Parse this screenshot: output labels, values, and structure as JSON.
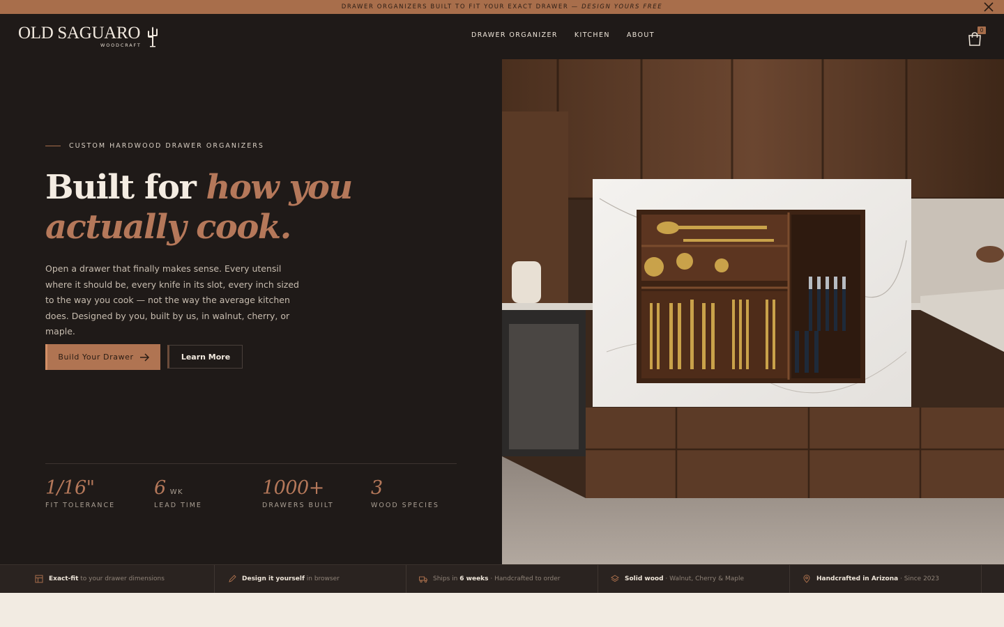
{
  "announcement": {
    "text": "DRAWER ORGANIZERS BUILT TO FIT YOUR EXACT DRAWER — ",
    "emphasis": "DESIGN YOURS FREE"
  },
  "header": {
    "logo_main": "OLD SAGUARO",
    "logo_sub": "WOODCRAFT",
    "nav": [
      "DRAWER ORGANIZER",
      "KITCHEN",
      "ABOUT"
    ],
    "cart_count": "0"
  },
  "hero": {
    "eyebrow": "CUSTOM HARDWOOD DRAWER ORGANIZERS",
    "headline_plain": "Built for ",
    "headline_accent": "how you actually cook.",
    "description": "Open a drawer that finally makes sense. Every utensil where it should be, every knife in its slot, every inch sized to the way you cook — not the way the average kitchen does. Designed by you, built by us, in walnut, cherry, or maple.",
    "primary_button": "Build Your Drawer",
    "secondary_button": "Learn More",
    "stats": [
      {
        "value": "1/16\"",
        "unit": "",
        "label": "FIT TOLERANCE"
      },
      {
        "value": "6",
        "unit": "WK",
        "label": "LEAD TIME"
      },
      {
        "value": "1000+",
        "unit": "",
        "label": "DRAWERS BUILT"
      },
      {
        "value": "3",
        "unit": "",
        "label": "WOOD SPECIES"
      }
    ]
  },
  "features": [
    {
      "icon": "ruler-icon",
      "bold": "Exact-fit",
      "rest": " to your drawer dimensions"
    },
    {
      "icon": "pencil-icon",
      "bold": "Design it yourself",
      "rest": " in browser"
    },
    {
      "icon": "truck-icon",
      "pre": "Ships in ",
      "bold": "6 weeks",
      "rest": " · Handcrafted to order"
    },
    {
      "icon": "layers-icon",
      "bold": "Solid wood",
      "rest": " · Walnut, Cherry & Maple"
    },
    {
      "icon": "location-pin-icon",
      "bold": "Handcrafted in Arizona",
      "rest": " · Since 2023"
    }
  ],
  "colors": {
    "accent": "#a86e4b",
    "dark_bg": "#1f1a18",
    "cream": "#f2ebe2"
  }
}
